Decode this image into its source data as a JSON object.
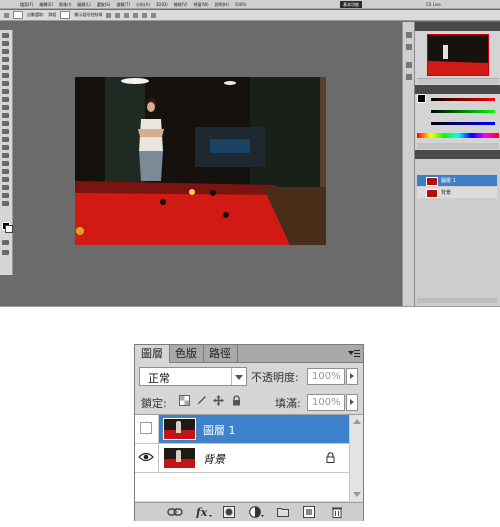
{
  "top_screenshot": {
    "menubar": {
      "items": [
        "檔案(F)",
        "編輯(E)",
        "影像(I)",
        "圖層(L)",
        "選取(S)",
        "濾鏡(T)",
        "分析(A)",
        "3D(D)",
        "檢視(V)",
        "視窗(W)",
        "說明(H)"
      ],
      "zoom": "100%",
      "workspace_active": "基本功能",
      "cs_live": "CS Live"
    },
    "options_bar": {
      "auto_select": "自動選取:",
      "auto_select_value": "群組",
      "show_transform": "顯示變形控制項"
    },
    "colors": {
      "workspace_bg": "#6b6b6b",
      "chrome": "#d6d6d6",
      "selection_blue": "#3f82cc"
    }
  },
  "layers_panel": {
    "tabs": [
      "圖層",
      "色版",
      "路徑"
    ],
    "active_tab": "圖層",
    "blend_mode": "正常",
    "opacity_label": "不透明度:",
    "opacity_value": "100%",
    "lock_label": "鎖定:",
    "fill_label": "填滿:",
    "fill_value": "100%",
    "layers": [
      {
        "name": "圖層 1",
        "selected": true,
        "visible": false
      },
      {
        "name": "背景",
        "selected": false,
        "visible": true,
        "locked": true
      }
    ],
    "footer_icons": [
      "link-icon",
      "fx-icon",
      "mask-icon",
      "adjustment-icon",
      "group-folder-icon",
      "new-layer-icon",
      "trash-icon"
    ]
  }
}
